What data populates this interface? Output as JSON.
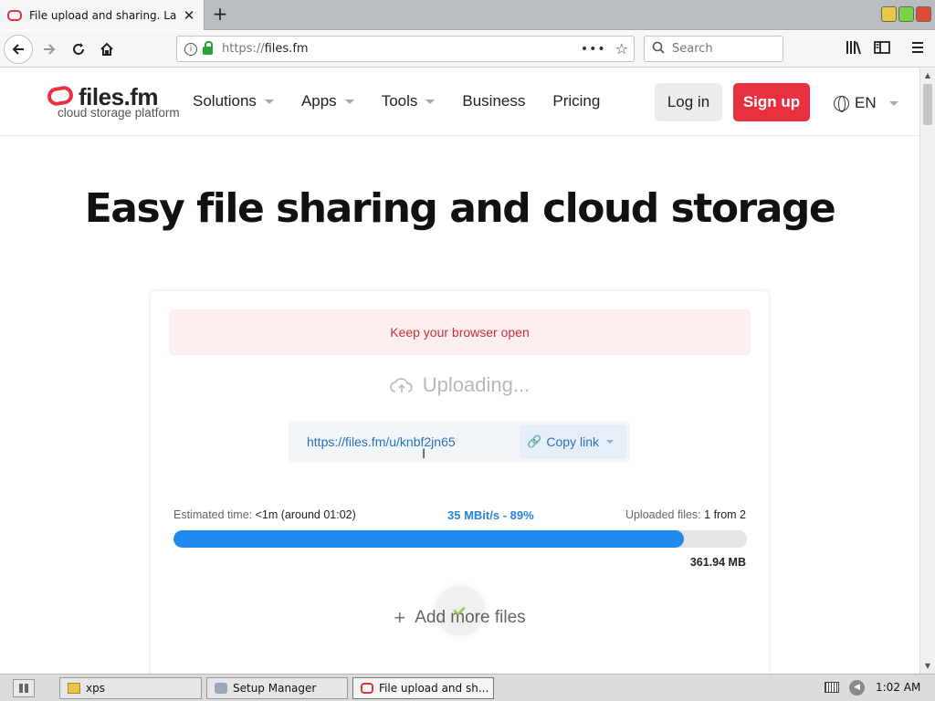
{
  "browser": {
    "tab_title": "File upload and sharing. Large",
    "new_tab": "+",
    "url_prefix": "https://",
    "url_domain": "files.fm",
    "search_placeholder": "Search"
  },
  "site": {
    "logo_brand": "files.fm",
    "logo_tagline": "cloud storage platform",
    "nav": [
      "Solutions",
      "Apps",
      "Tools",
      "Business",
      "Pricing"
    ],
    "login_label": "Log in",
    "signup_label": "Sign up",
    "language": "EN",
    "hero_title": "Easy file sharing and cloud storage"
  },
  "upload": {
    "alert": "Keep your browser open",
    "status": "Uploading...",
    "share_link": "https://files.fm/u/knbf2jn65",
    "copy_label": "Copy link",
    "estimated_label": "Estimated time:",
    "estimated_value": "<1m (around 01:02)",
    "speed": "35 MBit/s - 89%",
    "uploaded_label": "Uploaded files:",
    "uploaded_value": "1 from 2",
    "progress_percent": 89,
    "size": "361.94 MB",
    "add_more": "Add more files"
  },
  "taskbar": {
    "tasks": [
      "xps",
      "Setup Manager",
      "File upload and sh..."
    ],
    "clock": "1:02 AM"
  },
  "colors": {
    "brand_red": "#e8303f",
    "progress_blue": "#1e8af0",
    "link_blue": "#2a6fb8"
  }
}
